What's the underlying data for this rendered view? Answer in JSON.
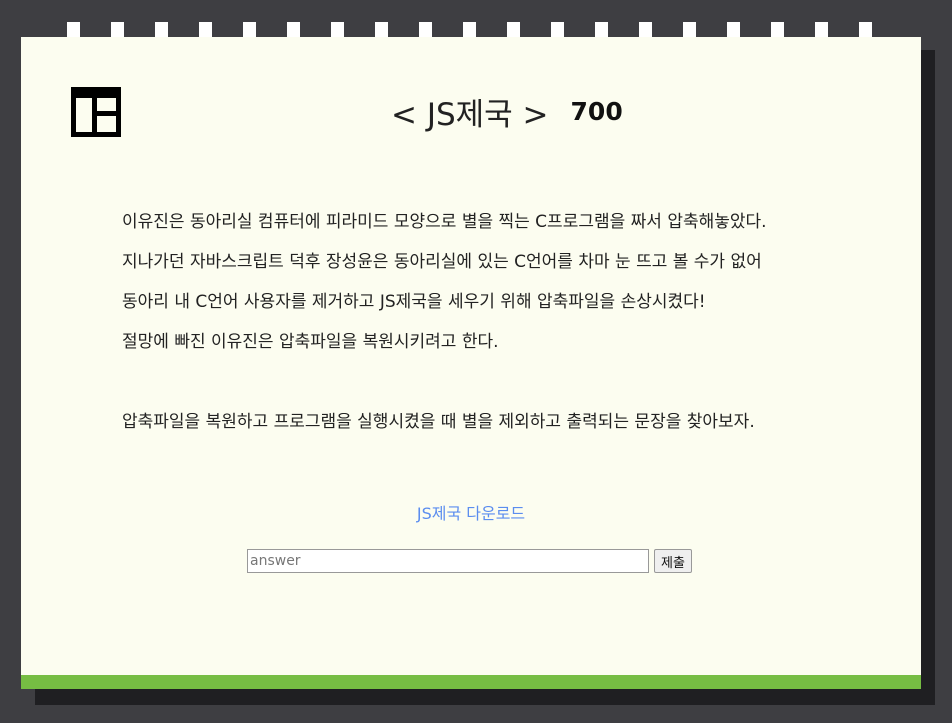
{
  "header": {
    "title": "< JS제국 >",
    "score": "700"
  },
  "logo": {
    "icon": "layout-icon"
  },
  "description": {
    "lines": [
      "이유진은 동아리실 컴퓨터에 피라미드 모양으로 별을 찍는 C프로그램을 짜서 압축해놓았다.",
      "지나가던 자바스크립트 덕후 장성윤은 동아리실에 있는 C언어를 차마 눈 뜨고 볼 수가 없어",
      "동아리 내 C언어 사용자를 제거하고 JS제국을 세우기 위해 압축파일을 손상시켰다!",
      "절망에 빠진 이유진은 압축파일을 복원시키려고 한다."
    ],
    "task": "압축파일을 복원하고 프로그램을 실행시켰을 때 별을 제외하고 출력되는 문장을 찾아보자."
  },
  "download": {
    "label": "JS제국 다운로드"
  },
  "answer": {
    "placeholder": "answer",
    "value": "",
    "submit_label": "제출"
  },
  "colors": {
    "background": "#3e3e42",
    "card": "#fcfdf0",
    "accent_bar": "#76bd43",
    "link": "#5b8def"
  }
}
